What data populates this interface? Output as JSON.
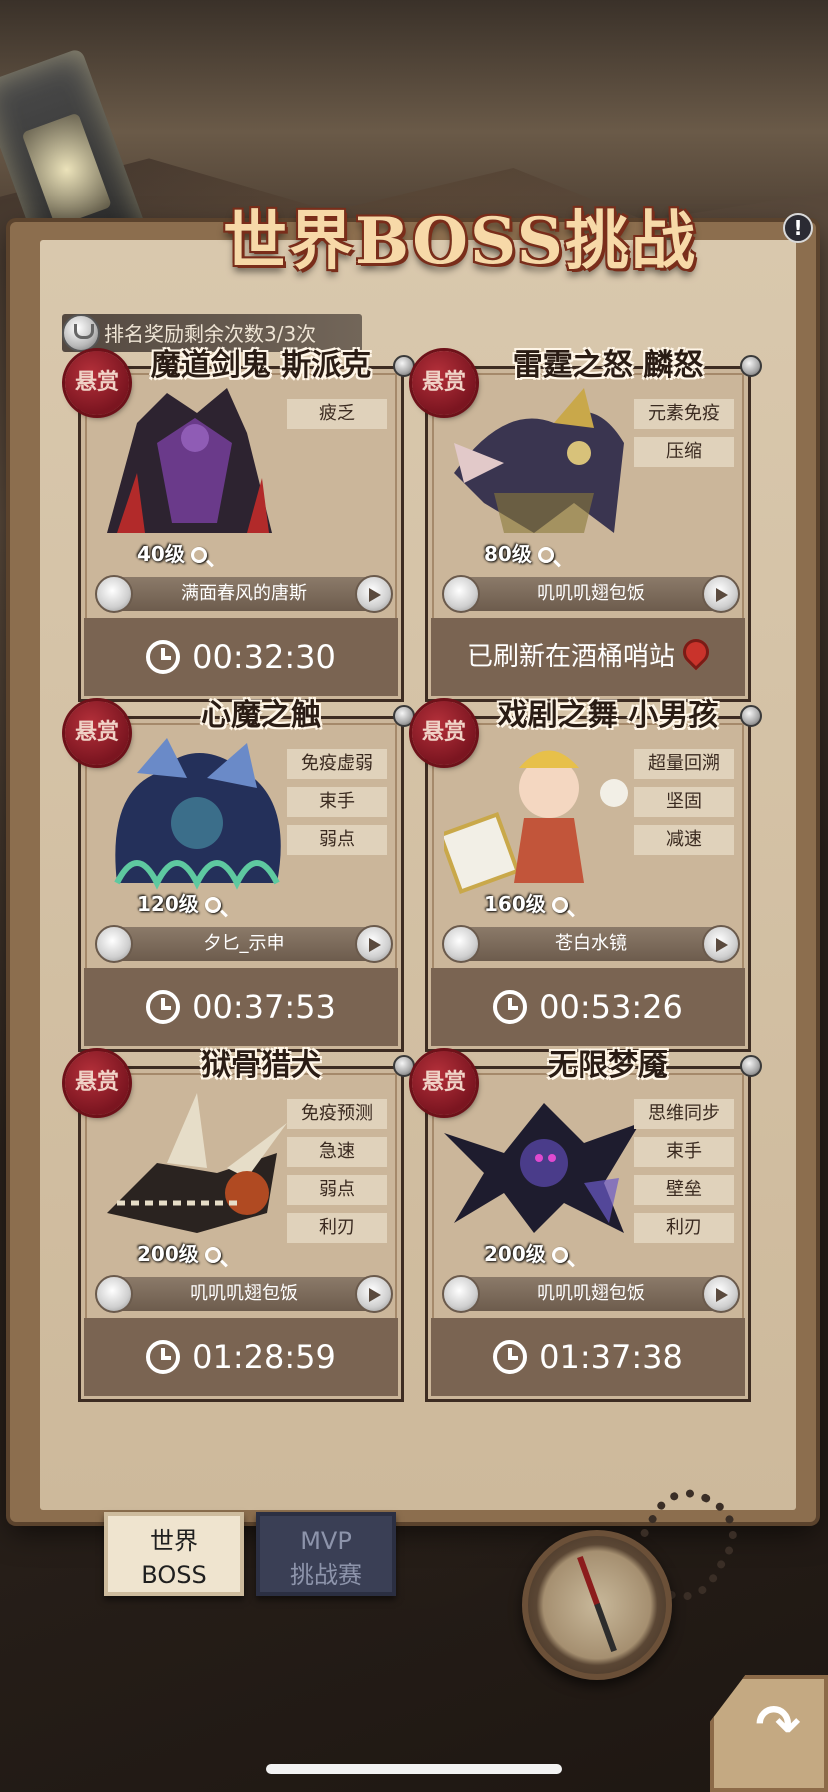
{
  "header": {
    "title": "世界BOSS挑战",
    "info_icon": "info-icon",
    "reward_text": "排名奖励剩余次数3/3次"
  },
  "seal_label": "悬赏",
  "cards": [
    {
      "name": "魔道剑鬼 斯派克",
      "tags": [
        "疲乏"
      ],
      "level": "40级",
      "owner": "满面春风的唐斯",
      "footer": "00:32:30",
      "footer_type": "timer",
      "accent": "#6a3a8a"
    },
    {
      "name": "雷霆之怒 麟怒",
      "tags": [
        "元素免疫",
        "压缩"
      ],
      "level": "80级",
      "owner": "叽叽叽翅包饭",
      "footer": "已刷新在酒桶哨站",
      "footer_type": "location",
      "accent": "#c9a84a"
    },
    {
      "name": "心魔之触",
      "tags": [
        "免疫虚弱",
        "束手",
        "弱点"
      ],
      "level": "120级",
      "owner": "夕匕_示申",
      "footer": "00:37:53",
      "footer_type": "timer",
      "accent": "#3b6e8a"
    },
    {
      "name": "戏剧之舞 小男孩",
      "tags": [
        "超量回溯",
        "坚固",
        "减速"
      ],
      "level": "160级",
      "owner": "苍白水镜",
      "footer": "00:53:26",
      "footer_type": "timer",
      "accent": "#c2553a"
    },
    {
      "name": "狱骨猎犬",
      "tags": [
        "免疫预测",
        "急速",
        "弱点",
        "利刃"
      ],
      "level": "200级",
      "owner": "叽叽叽翅包饭",
      "footer": "01:28:59",
      "footer_type": "timer",
      "accent": "#b04a22"
    },
    {
      "name": "无限梦魇",
      "tags": [
        "思维同步",
        "束手",
        "壁垒",
        "利刃"
      ],
      "level": "200级",
      "owner": "叽叽叽翅包饭",
      "footer": "01:37:38",
      "footer_type": "timer",
      "accent": "#4a3c8a"
    }
  ],
  "tabs": [
    {
      "label_line1": "世界",
      "label_line2": "BOSS",
      "active": true
    },
    {
      "label_line1": "MVP",
      "label_line2": "挑战赛",
      "active": false
    }
  ]
}
